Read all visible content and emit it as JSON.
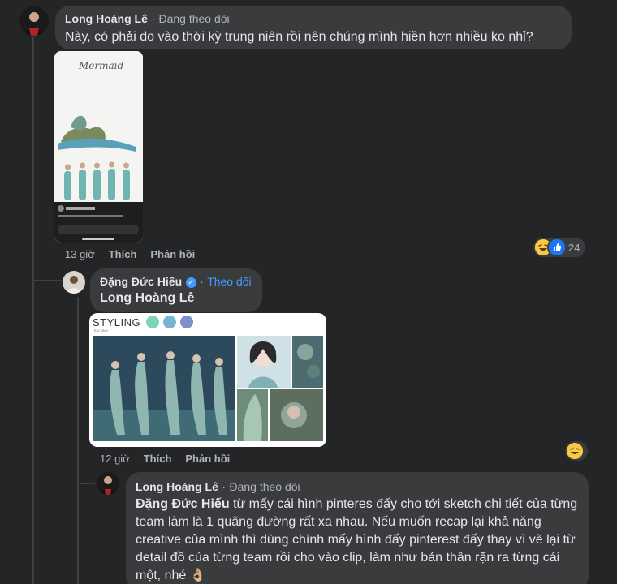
{
  "comments": [
    {
      "author": "Long Hoàng Lê",
      "separator": "·",
      "follow_status": "Đang theo dõi",
      "text": "Này, có phải do vào thời kỳ trung niên rồi nên chúng mình hiền hơn nhiều ko nhỉ?",
      "image": {
        "title": "Mermaid",
        "caption_user": "Đặng Đức Hiếu",
        "caption_text": "Mermaid sketch for styling with the... Xem thêm",
        "reply_box": "Thêm bình luận"
      },
      "time": "13 giờ",
      "like_label": "Thích",
      "reply_label": "Phản hồi",
      "reaction_count": "24",
      "reaction_icons": [
        "laughing-emoji-icon",
        "like-thumb-icon"
      ]
    },
    {
      "author": "Đặng Đức Hiếu",
      "separator": "·",
      "follow_status": "Theo dõi",
      "mention": "Long Hoàng Lê",
      "image": {
        "heading": "STYLING",
        "subheading": "EM XINH",
        "swatches": [
          "#7fd4b6",
          "#79b4d6",
          "#7f8fc9"
        ]
      },
      "time": "12 giờ",
      "like_label": "Thích",
      "reply_label": "Phản hồi",
      "reaction_icons": [
        "laughing-emoji-icon"
      ]
    },
    {
      "author": "Long Hoàng Lê",
      "separator": "·",
      "follow_status": "Đang theo dõi",
      "mention": "Đặng Đức Hiếu",
      "text": "từ mấy cái hình pinteres đấy cho tới sketch chi tiết của từng team làm là 1 quãng đường rất xa nhau. Nếu muốn recap lại khả năng creative của mình thì dùng chính mấy hình đấy pinterest đấy thay vì vẽ lại từ detail đồ của từng team rồi cho vào clip, làm như bản thân rặn ra từng cái một, nhé",
      "emoji": "👌🏼"
    }
  ],
  "colors": {
    "background": "#242526",
    "bubble": "#3a3b3c",
    "link": "#4599ff",
    "muted": "#b0b3b8"
  }
}
